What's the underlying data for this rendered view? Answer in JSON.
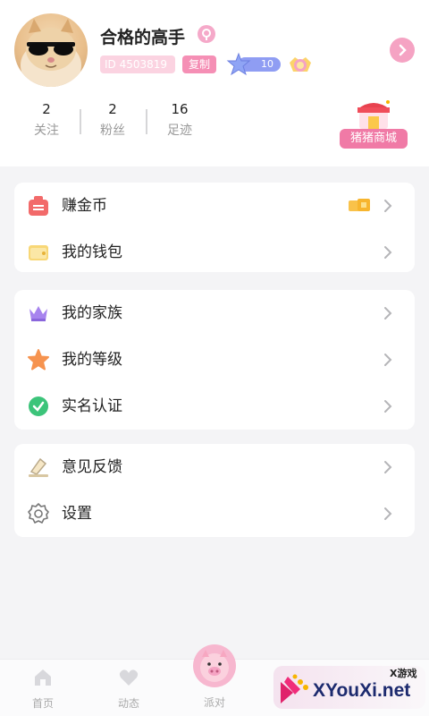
{
  "profile": {
    "nickname": "合格的高手",
    "id_text": "ID 4503819",
    "copy_label": "复制",
    "level": "10",
    "avatar": "cat-with-sunglasses"
  },
  "stats": [
    {
      "value": "2",
      "label": "关注"
    },
    {
      "value": "2",
      "label": "粉丝"
    },
    {
      "value": "16",
      "label": "足迹"
    }
  ],
  "shop": {
    "label": "猪猪商城",
    "icon": "shop-icon"
  },
  "menu_groups": [
    [
      {
        "label": "赚金币",
        "icon": "coin-bag-icon"
      },
      {
        "label": "我的钱包",
        "icon": "wallet-icon"
      }
    ],
    [
      {
        "label": "我的家族",
        "icon": "crown-icon"
      },
      {
        "label": "我的等级",
        "icon": "star-icon"
      },
      {
        "label": "实名认证",
        "icon": "verified-icon"
      }
    ],
    [
      {
        "label": "意见反馈",
        "icon": "feedback-icon"
      },
      {
        "label": "设置",
        "icon": "gear-icon"
      }
    ]
  ],
  "tabbar": {
    "home": "首页",
    "feed": "动态",
    "party": "派对"
  },
  "watermark": {
    "small": "X游戏",
    "main": "XYouXi.net"
  },
  "colors": {
    "accent_pink": "#f07aa6",
    "badge_pink": "#f58fb5",
    "level_blue": "#8f9df3",
    "background": "#f4f4f6"
  }
}
